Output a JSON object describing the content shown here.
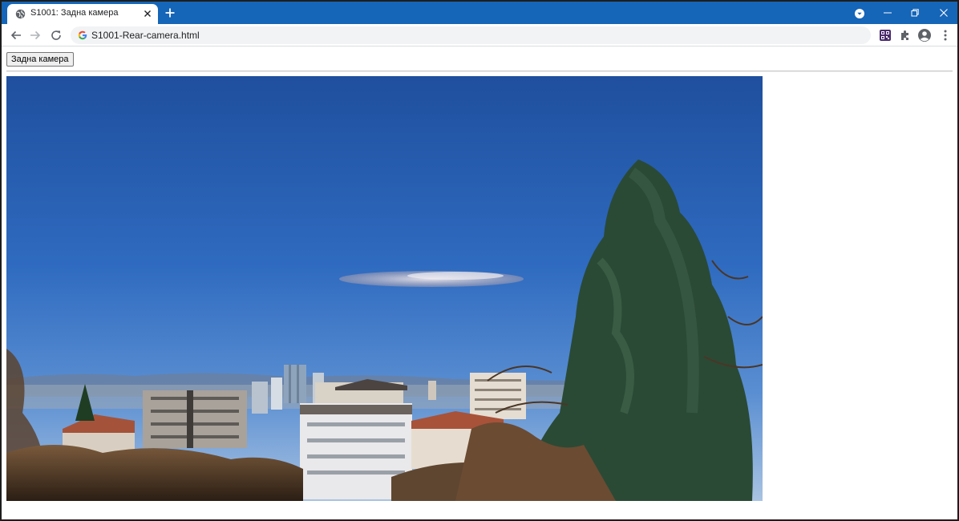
{
  "browser": {
    "tab": {
      "title": "S1001: Задна камера",
      "favicon": "globe-icon"
    },
    "address_bar": {
      "url": "S1001-Rear-camera.html"
    },
    "colors": {
      "tabstrip": "#1565b8",
      "omnibox": "#f1f3f4"
    }
  },
  "page": {
    "camera_button_label": "Задна камера",
    "photo_description_label": ""
  }
}
